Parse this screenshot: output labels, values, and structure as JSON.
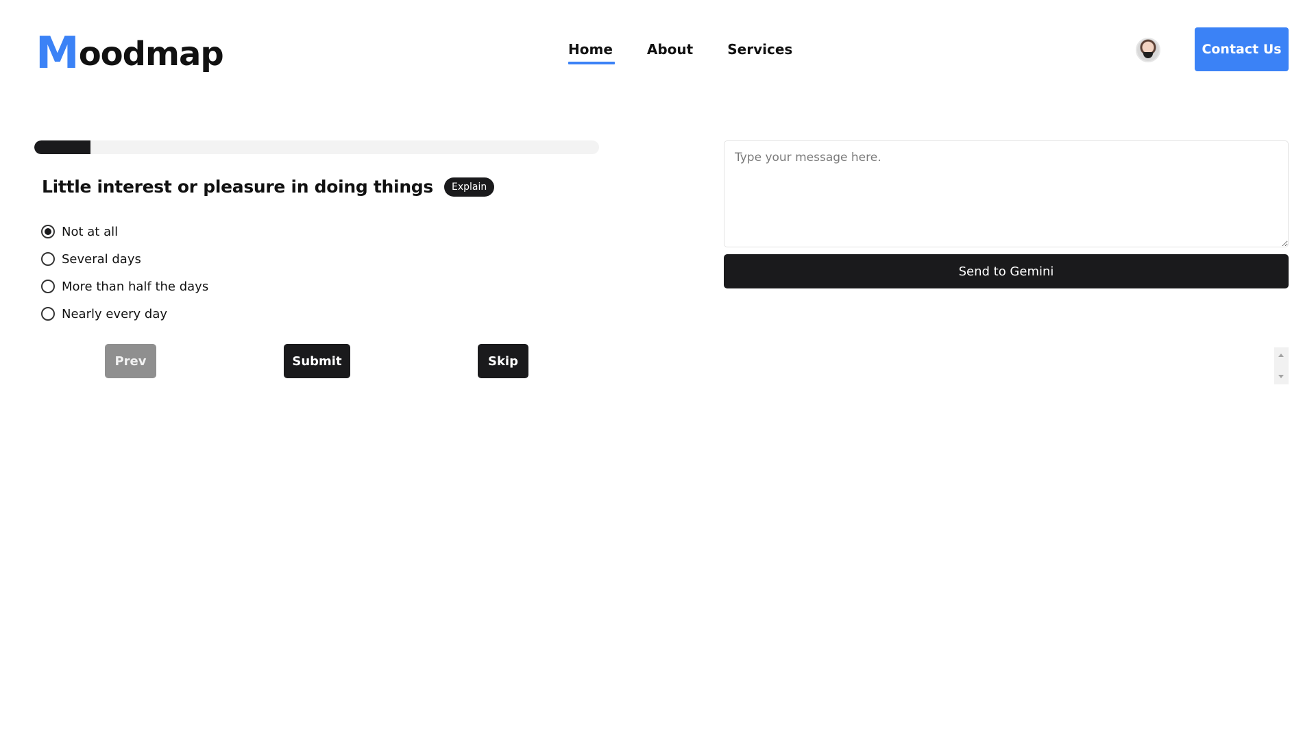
{
  "brand": {
    "initial": "M",
    "rest": "oodmap",
    "accent_color": "#3b82f6"
  },
  "nav": {
    "items": [
      {
        "label": "Home",
        "active": true
      },
      {
        "label": "About",
        "active": false
      },
      {
        "label": "Services",
        "active": false
      }
    ],
    "contact_label": "Contact Us"
  },
  "avatar": {
    "icon": "user-avatar"
  },
  "questionnaire": {
    "progress_fraction": 0.1,
    "question": "Little interest or pleasure in doing things",
    "explain_label": "Explain",
    "options": [
      {
        "label": "Not at all",
        "selected": true
      },
      {
        "label": "Several days",
        "selected": false
      },
      {
        "label": "More than half the days",
        "selected": false
      },
      {
        "label": "Nearly every day",
        "selected": false
      }
    ],
    "buttons": {
      "prev": "Prev",
      "submit": "Submit",
      "skip": "Skip"
    }
  },
  "chat": {
    "placeholder": "Type your message here.",
    "value": "",
    "send_label": "Send to Gemini"
  },
  "colors": {
    "dark": "#1a1a1c",
    "disabled": "#8f8f8f",
    "track": "#f3f3f3"
  }
}
